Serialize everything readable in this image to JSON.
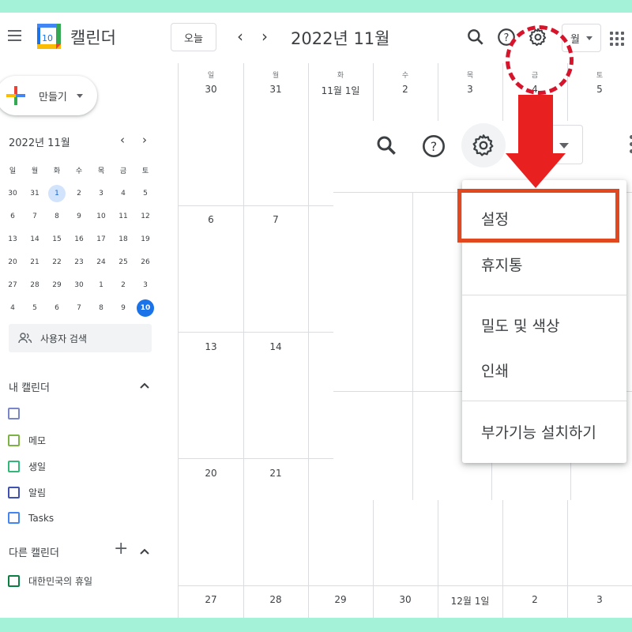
{
  "header": {
    "app_title": "캘린더",
    "logo_number": "10",
    "today_label": "오늘",
    "prev": "‹",
    "next": "›",
    "month_title": "2022년 11월",
    "view_label": "월"
  },
  "sidebar": {
    "create_label": "만들기",
    "mini_calendar": {
      "title": "2022년 11월",
      "weekdays": [
        "일",
        "월",
        "화",
        "수",
        "목",
        "금",
        "토"
      ],
      "weeks": [
        [
          "30",
          "31",
          "1",
          "2",
          "3",
          "4",
          "5"
        ],
        [
          "6",
          "7",
          "8",
          "9",
          "10",
          "11",
          "12"
        ],
        [
          "13",
          "14",
          "15",
          "16",
          "17",
          "18",
          "19"
        ],
        [
          "20",
          "21",
          "22",
          "23",
          "24",
          "25",
          "26"
        ],
        [
          "27",
          "28",
          "29",
          "30",
          "1",
          "2",
          "3"
        ],
        [
          "4",
          "5",
          "6",
          "7",
          "8",
          "9",
          "10"
        ]
      ]
    },
    "people_search_placeholder": "사용자 검색",
    "my_calendars_title": "내 캘린더",
    "my_calendars": [
      {
        "label": "",
        "color": "#7986cb"
      },
      {
        "label": "메모",
        "color": "#7cb342"
      },
      {
        "label": "생일",
        "color": "#33b679"
      },
      {
        "label": "알림",
        "color": "#3f51b5"
      },
      {
        "label": "Tasks",
        "color": "#4285f4"
      }
    ],
    "other_calendars_title": "다른 캘린더",
    "other_calendars": [
      {
        "label": "대한민국의 휴일",
        "color": "#0b8043"
      }
    ]
  },
  "grid": {
    "weekdays": [
      "일",
      "월",
      "화",
      "수",
      "목",
      "금",
      "토"
    ],
    "first_row_dates": [
      "30",
      "31",
      "11월 1일",
      "2",
      "3",
      "4",
      "5"
    ],
    "week2": [
      "6",
      "7"
    ],
    "week3": [
      "13",
      "14"
    ],
    "week4": [
      "20",
      "21"
    ],
    "last_row_dates": [
      "27",
      "28",
      "29",
      "30",
      "12월 1일",
      "2",
      "3"
    ]
  },
  "settings_menu": {
    "items": [
      "설정",
      "휴지통",
      "밀도 및 색상",
      "인쇄",
      "부가기능 설치하기"
    ]
  },
  "colors": {
    "accent": "#1a73e8",
    "highlight_box": "#e2481f",
    "annotation_red": "#d6152c",
    "background_border": "#a4f2d8"
  }
}
